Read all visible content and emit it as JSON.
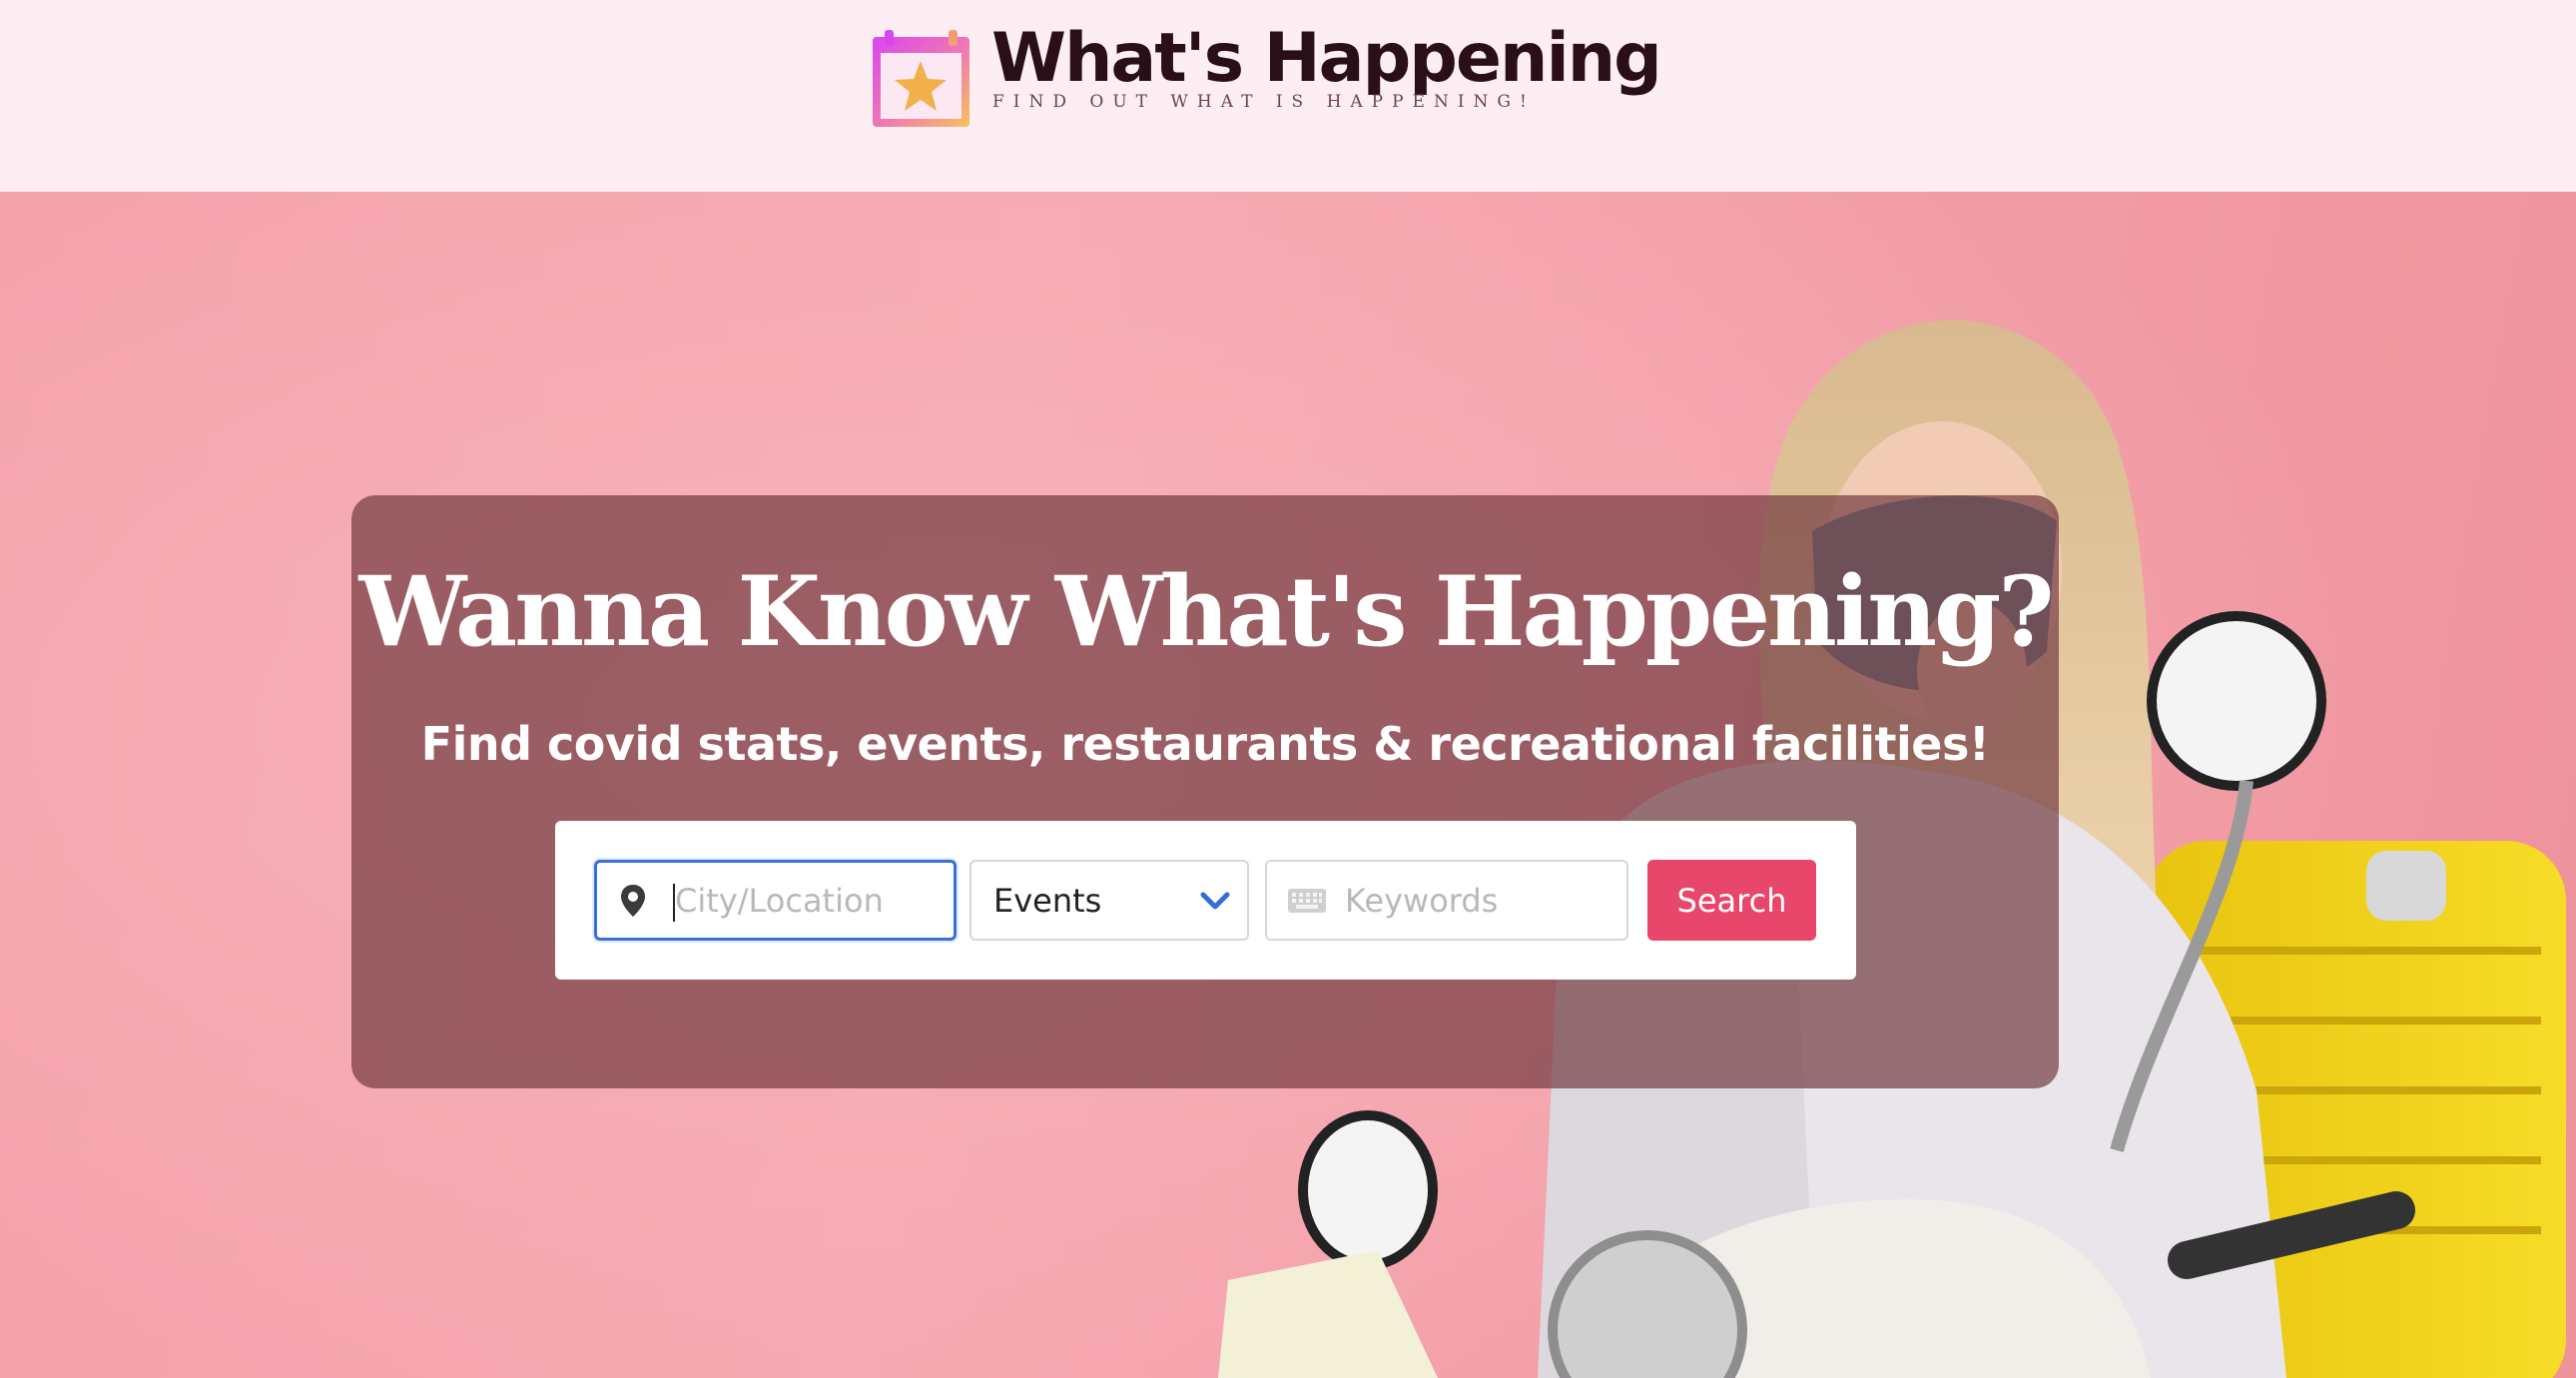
{
  "header": {
    "brand_title": "What's Happening",
    "tagline": "FIND OUT WHAT IS HAPPENING!",
    "logo_icon": "calendar-star-icon"
  },
  "hero": {
    "title": "Wanna Know What's Happening?",
    "subtitle": "Find covid stats, events, restaurants & recreational facilities!",
    "background_image": "woman-with-mask-on-scooter-photo"
  },
  "search": {
    "location_placeholder": "City/Location",
    "location_value": "",
    "location_icon": "map-pin-icon",
    "category_selected": "Events",
    "category_icon": "chevron-down-icon",
    "keywords_placeholder": "Keywords",
    "keywords_icon": "keyboard-icon",
    "button_label": "Search"
  },
  "colors": {
    "header_bg": "#fdeef4",
    "hero_bg": "#f4a3ac",
    "overlay": "#6e373c",
    "accent": "#e8466a",
    "focus": "#3a6fd8"
  }
}
